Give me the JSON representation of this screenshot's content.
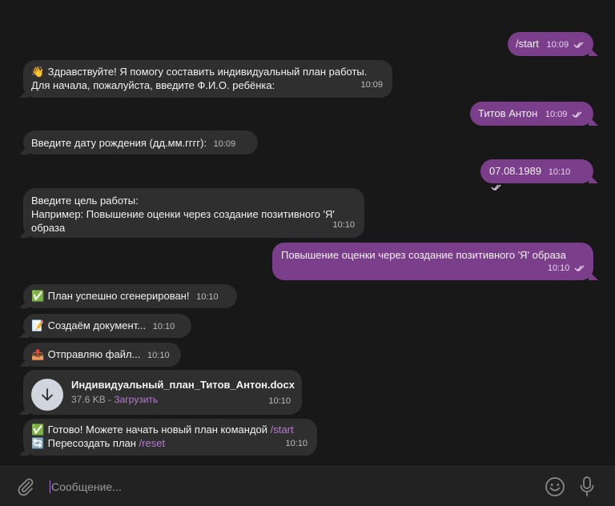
{
  "chat": {
    "messages": [
      {
        "id": 1,
        "dir": "out",
        "lines": [
          "/start"
        ],
        "time": "10:09",
        "read": true
      },
      {
        "id": 2,
        "dir": "in",
        "emoji": "👋",
        "lines": [
          "Здравствуйте! Я помогу составить индивидуальный план работы.",
          "Для начала, пожалуйста, введите Ф.И.О. ребёнка:"
        ],
        "time": "10:09"
      },
      {
        "id": 3,
        "dir": "out",
        "lines": [
          "Титов Антон"
        ],
        "time": "10:09",
        "read": true
      },
      {
        "id": 4,
        "dir": "in",
        "lines": [
          "Введите дату рождения (дд.мм.гггг):"
        ],
        "time": "10:09"
      },
      {
        "id": 5,
        "dir": "out",
        "lines": [
          "07.08.1989"
        ],
        "time": "10:10",
        "read": true
      },
      {
        "id": 6,
        "dir": "in",
        "lines": [
          "Введите цель работы:",
          "Например: Повышение оценки через создание позитивного 'Я'",
          "образа"
        ],
        "time": "10:10"
      },
      {
        "id": 7,
        "dir": "out",
        "lines": [
          "Повышение оценки через создание позитивного 'Я' образа"
        ],
        "time": "10:10",
        "read": true
      },
      {
        "id": 8,
        "dir": "in",
        "emoji": "✅",
        "lines": [
          "План успешно сгенерирован!"
        ],
        "time": "10:10"
      },
      {
        "id": 9,
        "dir": "in",
        "emoji": "📝",
        "lines": [
          "Создаём документ..."
        ],
        "time": "10:10"
      },
      {
        "id": 10,
        "dir": "in",
        "emoji": "📤",
        "lines": [
          "Отправляю файл..."
        ],
        "time": "10:10"
      },
      {
        "id": 11,
        "dir": "in",
        "type": "file",
        "filename": "Индивидуальный_план_Титов_Антон.docx",
        "size": "37.6 KB",
        "separator": " - ",
        "download_label": "Загрузить",
        "time": "10:10"
      },
      {
        "id": 12,
        "dir": "in",
        "line1_emoji": "✅",
        "line1_text": "Готово! Можете начать новый план командой ",
        "line1_cmd": "/start",
        "line2_emoji": "🔄",
        "line2_text": "Пересоздать план ",
        "line2_cmd": "/reset",
        "time": "10:10"
      }
    ]
  },
  "composer": {
    "placeholder": "Сообщение...",
    "attach_icon": "paperclip-icon",
    "emoji_icon": "smiley-icon",
    "mic_icon": "microphone-icon"
  },
  "colors": {
    "background": "#181818",
    "incoming_bubble": "#2f2f2f",
    "outgoing_bubble": "#7b3e8b",
    "command_link": "#b57ccf",
    "input_bar": "#222222"
  }
}
